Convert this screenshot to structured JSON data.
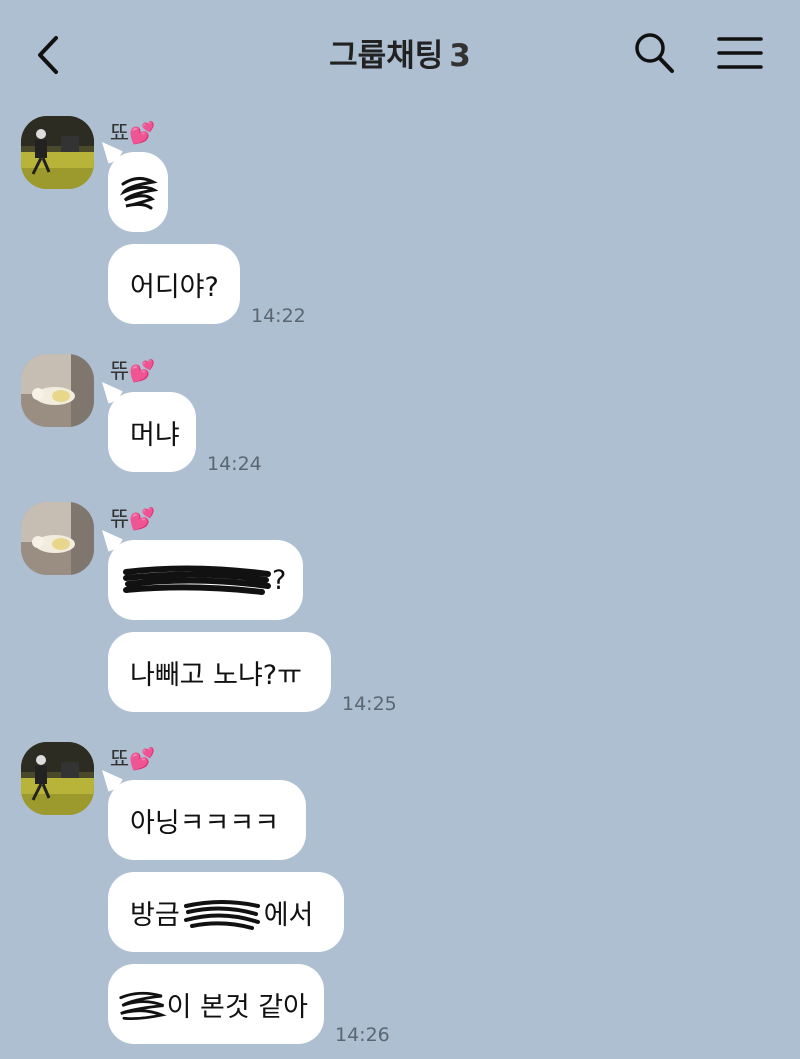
{
  "header": {
    "title": "그룹채팅",
    "member_count": "3"
  },
  "icons": {
    "back": "chevron-left-icon",
    "search": "search-icon",
    "menu": "hamburger-menu-icon"
  },
  "colors": {
    "background": "#aebfd2",
    "bubble": "#ffffff",
    "heart": "#e8509f"
  },
  "groups": [
    {
      "sender": "뚀",
      "sender_emoji": "💕",
      "avatar": "avatar-person-photo",
      "messages": [
        {
          "text": "",
          "redacted": true
        },
        {
          "text": "어디야?",
          "time": "14:22"
        }
      ]
    },
    {
      "sender": "뜌",
      "sender_emoji": "💕",
      "avatar": "avatar-dog-photo",
      "messages": [
        {
          "text": "머냐",
          "time": "14:24"
        }
      ]
    },
    {
      "sender": "뜌",
      "sender_emoji": "💕",
      "avatar": "avatar-dog-photo",
      "messages": [
        {
          "text": "",
          "redacted": true,
          "suffix": "?"
        },
        {
          "text": "나빼고 노냐?ㅠ",
          "time": "14:25"
        }
      ]
    },
    {
      "sender": "뚀",
      "sender_emoji": "💕",
      "avatar": "avatar-person-photo",
      "messages": [
        {
          "text": "아닝ㅋㅋㅋㅋ"
        },
        {
          "prefix": "방금",
          "suffix": "에서"
        },
        {
          "suffix": "이 본것 같아",
          "time": "14:26"
        }
      ]
    }
  ]
}
